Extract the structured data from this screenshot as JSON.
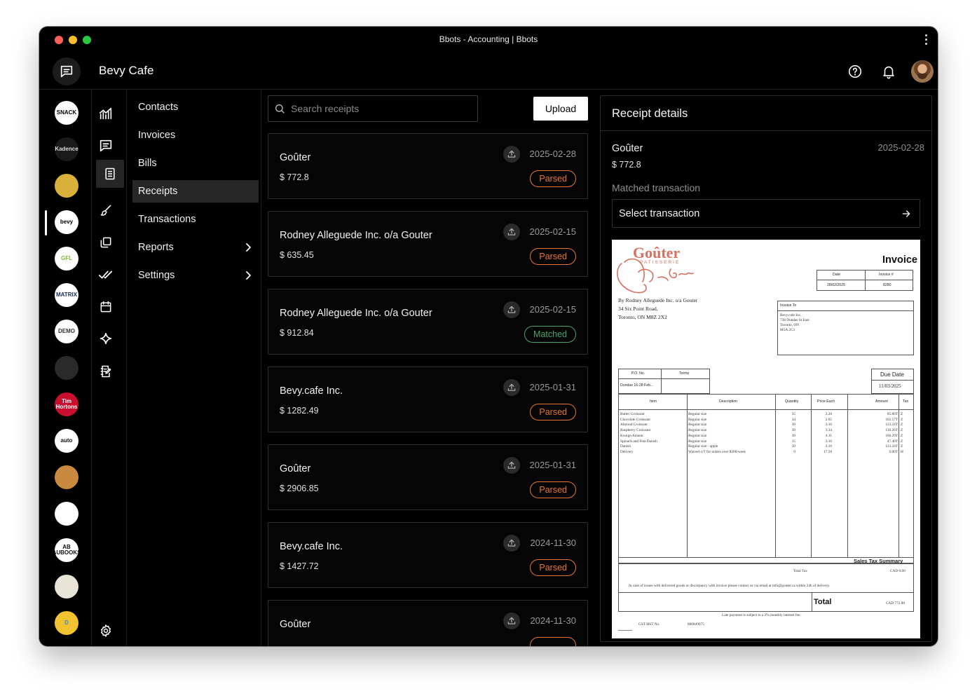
{
  "window": {
    "title": "Bbots - Accounting | Bbots"
  },
  "header": {
    "company_name": "Bevy Cafe",
    "help_icon": "help-circle-icon",
    "bell_icon": "bell-icon"
  },
  "companies": [
    {
      "label": "SNACK",
      "bg": "#ffffff",
      "fg": "#000000"
    },
    {
      "label": "Kadence",
      "bg": "#1a1a1a",
      "fg": "#dddddd"
    },
    {
      "label": "",
      "bg": "#d9b13a",
      "fg": "#6a4a10"
    },
    {
      "label": "bevy",
      "bg": "#ffffff",
      "fg": "#000000"
    },
    {
      "label": "GFL",
      "bg": "#ffffff",
      "fg": "#7bbf3a"
    },
    {
      "label": "MATRIX",
      "bg": "#ffffff",
      "fg": "#1a2a5a"
    },
    {
      "label": "DEMO",
      "bg": "#ffffff",
      "fg": "#333333"
    },
    {
      "label": "",
      "bg": "#2a2a2a",
      "fg": "#e8562a"
    },
    {
      "label": "Tim Hortons",
      "bg": "#c8102e",
      "fg": "#ffffff"
    },
    {
      "label": "auto",
      "bg": "#ffffff",
      "fg": "#111111"
    },
    {
      "label": "",
      "bg": "#c98a3f",
      "fg": "#ffffff"
    },
    {
      "label": "",
      "bg": "#ffffff",
      "fg": "#111111"
    },
    {
      "label": "AB AUBOOKS",
      "bg": "#ffffff",
      "fg": "#111111"
    },
    {
      "label": "",
      "bg": "#e8e4d8",
      "fg": "#333333"
    },
    {
      "label": "D",
      "bg": "#f2c230",
      "fg": "#3a8ad0"
    }
  ],
  "icon_rail": [
    {
      "name": "chart-icon",
      "active": false
    },
    {
      "name": "chat-icon",
      "active": false
    },
    {
      "name": "receipt-doc-icon",
      "active": true
    },
    {
      "name": "brush-icon",
      "active": false
    },
    {
      "name": "layers-icon",
      "active": false
    },
    {
      "name": "double-check-icon",
      "active": false
    },
    {
      "name": "calendar-icon",
      "active": false
    },
    {
      "name": "sparkle-icon",
      "active": false
    },
    {
      "name": "edit-notebook-icon",
      "active": false
    }
  ],
  "nav": {
    "items": [
      {
        "label": "Contacts",
        "active": false,
        "has_chevron": false
      },
      {
        "label": "Invoices",
        "active": false,
        "has_chevron": false
      },
      {
        "label": "Bills",
        "active": false,
        "has_chevron": false
      },
      {
        "label": "Receipts",
        "active": true,
        "has_chevron": false
      },
      {
        "label": "Transactions",
        "active": false,
        "has_chevron": false
      },
      {
        "label": "Reports",
        "active": false,
        "has_chevron": true
      },
      {
        "label": "Settings",
        "active": false,
        "has_chevron": true
      }
    ]
  },
  "search": {
    "placeholder": "Search receipts",
    "value": ""
  },
  "toolbar": {
    "upload_label": "Upload"
  },
  "receipts": [
    {
      "vendor": "Goûter",
      "amount": "$ 772.8",
      "date": "2025-02-28",
      "status": "Parsed"
    },
    {
      "vendor": "Rodney Alleguede Inc. o/a Gouter",
      "amount": "$ 635.45",
      "date": "2025-02-15",
      "status": "Parsed"
    },
    {
      "vendor": "Rodney Alleguede Inc. o/a Gouter",
      "amount": "$ 912.84",
      "date": "2025-02-15",
      "status": "Matched"
    },
    {
      "vendor": "Bevy.cafe Inc.",
      "amount": "$ 1282.49",
      "date": "2025-01-31",
      "status": "Parsed"
    },
    {
      "vendor": "Goûter",
      "amount": "$ 2906.85",
      "date": "2025-01-31",
      "status": "Parsed"
    },
    {
      "vendor": "Bevy.cafe Inc.",
      "amount": "$ 1427.72",
      "date": "2024-11-30",
      "status": "Parsed"
    },
    {
      "vendor": "Goûter",
      "amount": "",
      "date": "2024-11-30",
      "status": ""
    }
  ],
  "status_colors": {
    "Parsed": "#e8762f",
    "Matched": "#49a56a"
  },
  "details": {
    "heading": "Receipt details",
    "vendor": "Goûter",
    "date": "2025-02-28",
    "amount": "$ 772.8",
    "matched_label": "Matched transaction",
    "select_label": "Select transaction"
  },
  "invoice": {
    "brand": "Goûter",
    "brand_sub": "PATISSERIE",
    "title": "Invoice",
    "date_label": "Date",
    "date_value": "28/02/2025",
    "invoice_no_label": "Invoice #",
    "invoice_no_value": "8280",
    "from_lines": [
      "By Rodney Alleguede Inc. o/a Gouter",
      "34 Six Point Road,",
      "Toronto, ON M8Z 2X2"
    ],
    "invoice_to_label": "Invoice To",
    "invoice_to_lines": [
      "Bevy.cafe Inc.",
      "738 Dundas St East",
      "Toronto, ON",
      "M5A 2C3"
    ],
    "po_label": "P.O. No.",
    "po_value": "Dundas 16-28 Feb...",
    "terms_label": "Terms",
    "due_label": "Due Date",
    "due_value": "11/03/2025",
    "columns": [
      "Item",
      "Description",
      "Quantity",
      "Price Each",
      "Amount",
      "Tax"
    ],
    "rows": [
      [
        "Butter Croissant",
        "Regular size",
        "35",
        "2.20",
        "85.80T",
        "Z"
      ],
      [
        "Chocolate Croissant",
        "Regular size",
        "34",
        "2.65",
        "102.57T",
        "Z"
      ],
      [
        "Almond Croissant",
        "Regular size",
        "39",
        "3.16",
        "123.24T",
        "Z"
      ],
      [
        "Raspberry Croissant",
        "Regular size",
        "39",
        "3.34",
        "130.26T",
        "Z"
      ],
      [
        "Kouign Amann",
        "Regular size",
        "39",
        "4.11",
        "160.29T",
        "Z"
      ],
      [
        "Spinach and Feta Danish",
        "Regular size",
        "15",
        "3.16",
        "47.40T",
        "Z"
      ],
      [
        "Danish",
        "Regular size - apple",
        "39",
        "3.16",
        "123.24T",
        "Z"
      ],
      [
        "Delivery",
        "Waived o/T for orders over $300/week",
        "0",
        "17.50",
        "0.00T",
        "H"
      ]
    ],
    "sales_tax_summary": "Sales Tax Summary",
    "total_tax_label": "Total Tax",
    "total_tax_value": "CAD 0.00",
    "notice": "In case of issues with delivered goods or discrepancy with invoice please contact us via email at info@gouter.ca within 24h of delivery.",
    "total_label": "Total",
    "total_value": "CAD 772.80",
    "late_notice": "Late payment is subject to a 2% monthly interest fee.",
    "gst_label": "GST/HST No.",
    "gst_value": "800849075"
  }
}
